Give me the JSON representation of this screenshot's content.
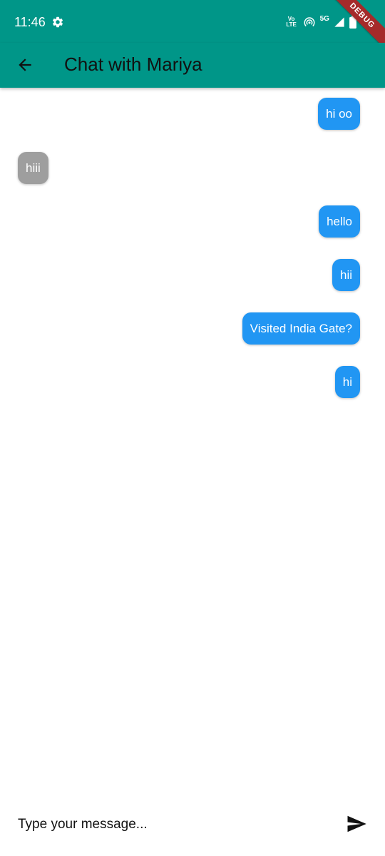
{
  "status_bar": {
    "time": "11:46",
    "gear_icon": "settings-gear-icon",
    "volte_top": "Vo",
    "volte_bottom": "LTE",
    "network": "5G",
    "battery": "92",
    "debug_banner": "DEBUG"
  },
  "app_bar": {
    "back_icon": "arrow-left-icon",
    "title": "Chat with Mariya",
    "background": "#009688"
  },
  "messages": [
    {
      "text": "hi oo",
      "side": "sent"
    },
    {
      "text": "hiii",
      "side": "received"
    },
    {
      "text": "hello",
      "side": "sent"
    },
    {
      "text": "hii",
      "side": "sent"
    },
    {
      "text": "Visited India Gate?",
      "side": "sent"
    },
    {
      "text": "hi",
      "side": "sent"
    }
  ],
  "colors": {
    "sent_bubble": "#2196f3",
    "received_bubble": "#9e9e9e"
  },
  "composer": {
    "placeholder": "Type your message...",
    "value": "",
    "send_icon": "send-icon"
  }
}
